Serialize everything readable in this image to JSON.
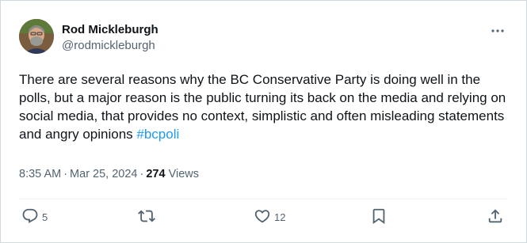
{
  "tweet": {
    "author": {
      "display_name": "Rod Mickleburgh",
      "handle": "@rodmickleburgh"
    },
    "text": {
      "body": "There are several reasons why the BC Conservative Party is doing well in the polls, but a major reason is the public turning its back on the media and relying on social media, that provides no context, simplistic and often misleading statements and angry opinions ",
      "hashtag": "#bcpoli"
    },
    "meta": {
      "time": "8:35 AM",
      "separator": "·",
      "date": "Mar 25, 2024",
      "views_count": "274",
      "views_label": "Views"
    },
    "actions": {
      "reply_count": "5",
      "retweet_count": "",
      "like_count": "12"
    },
    "icons": {
      "more": "more-horizontal-icon",
      "reply": "reply-icon",
      "retweet": "retweet-icon",
      "like": "heart-icon",
      "bookmark": "bookmark-icon",
      "share": "share-icon"
    },
    "colors": {
      "text_primary": "#0f1419",
      "text_secondary": "#536471",
      "hashtag": "#1d9bf0",
      "border": "#cfd9de"
    }
  }
}
